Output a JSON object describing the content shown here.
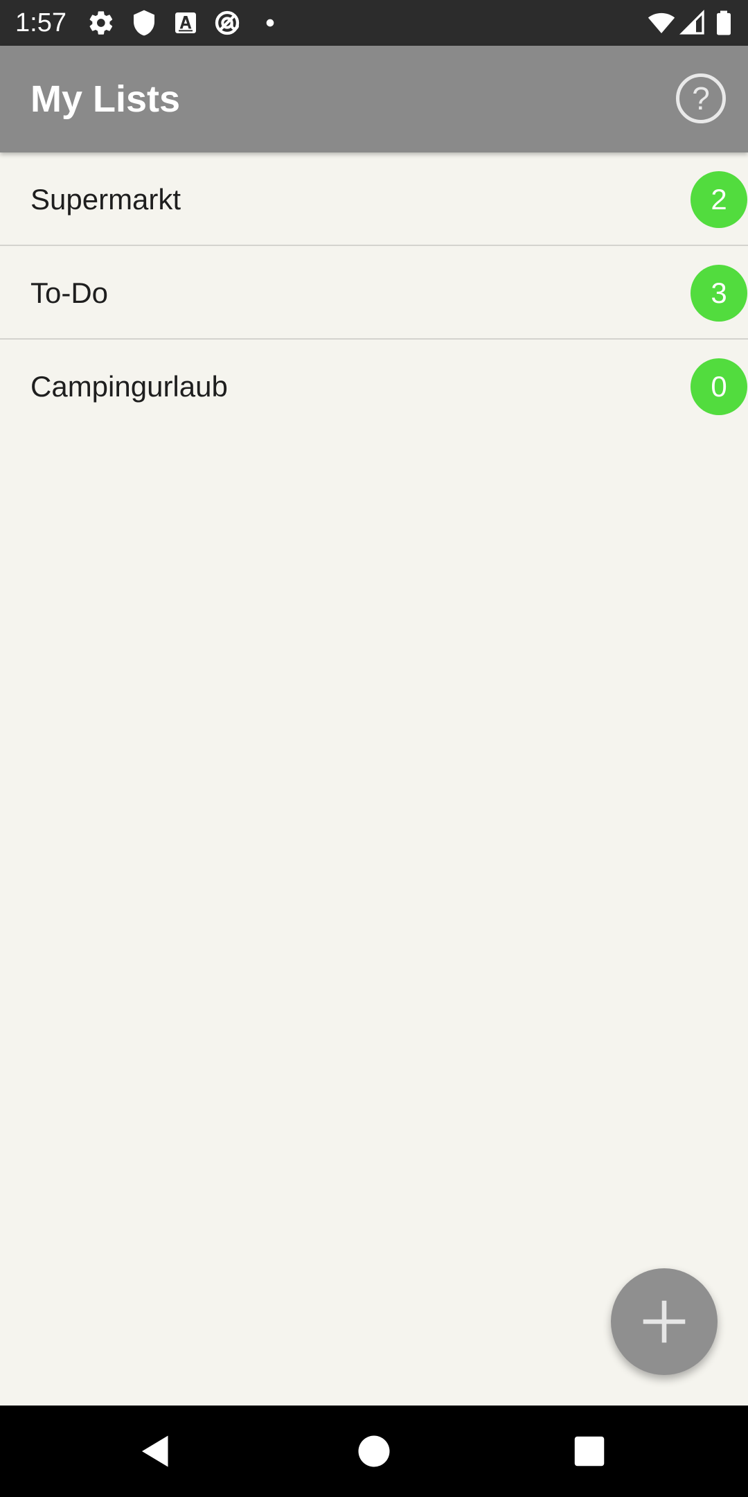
{
  "status_bar": {
    "time": "1:57",
    "icons_left": [
      "gear-icon",
      "shield-icon",
      "font-a-icon",
      "at-icon",
      "dot-icon"
    ],
    "icons_right": [
      "wifi-icon",
      "signal-icon",
      "battery-icon"
    ]
  },
  "app_bar": {
    "title": "My Lists",
    "help_label": "?"
  },
  "lists": [
    {
      "name": "Supermarkt",
      "count": "2"
    },
    {
      "name": "To-Do",
      "count": "3"
    },
    {
      "name": "Campingurlaub",
      "count": "0"
    }
  ],
  "fab": {
    "icon": "plus-icon"
  },
  "nav_bar": {
    "buttons": [
      "back-icon",
      "home-icon",
      "recents-icon"
    ]
  },
  "colors": {
    "status_bar": "#2c2c2c",
    "app_bar": "#8a8a8a",
    "background": "#f5f4ee",
    "badge": "#52dc3e",
    "fab": "#8f8f8f",
    "nav_bar": "#000000"
  }
}
